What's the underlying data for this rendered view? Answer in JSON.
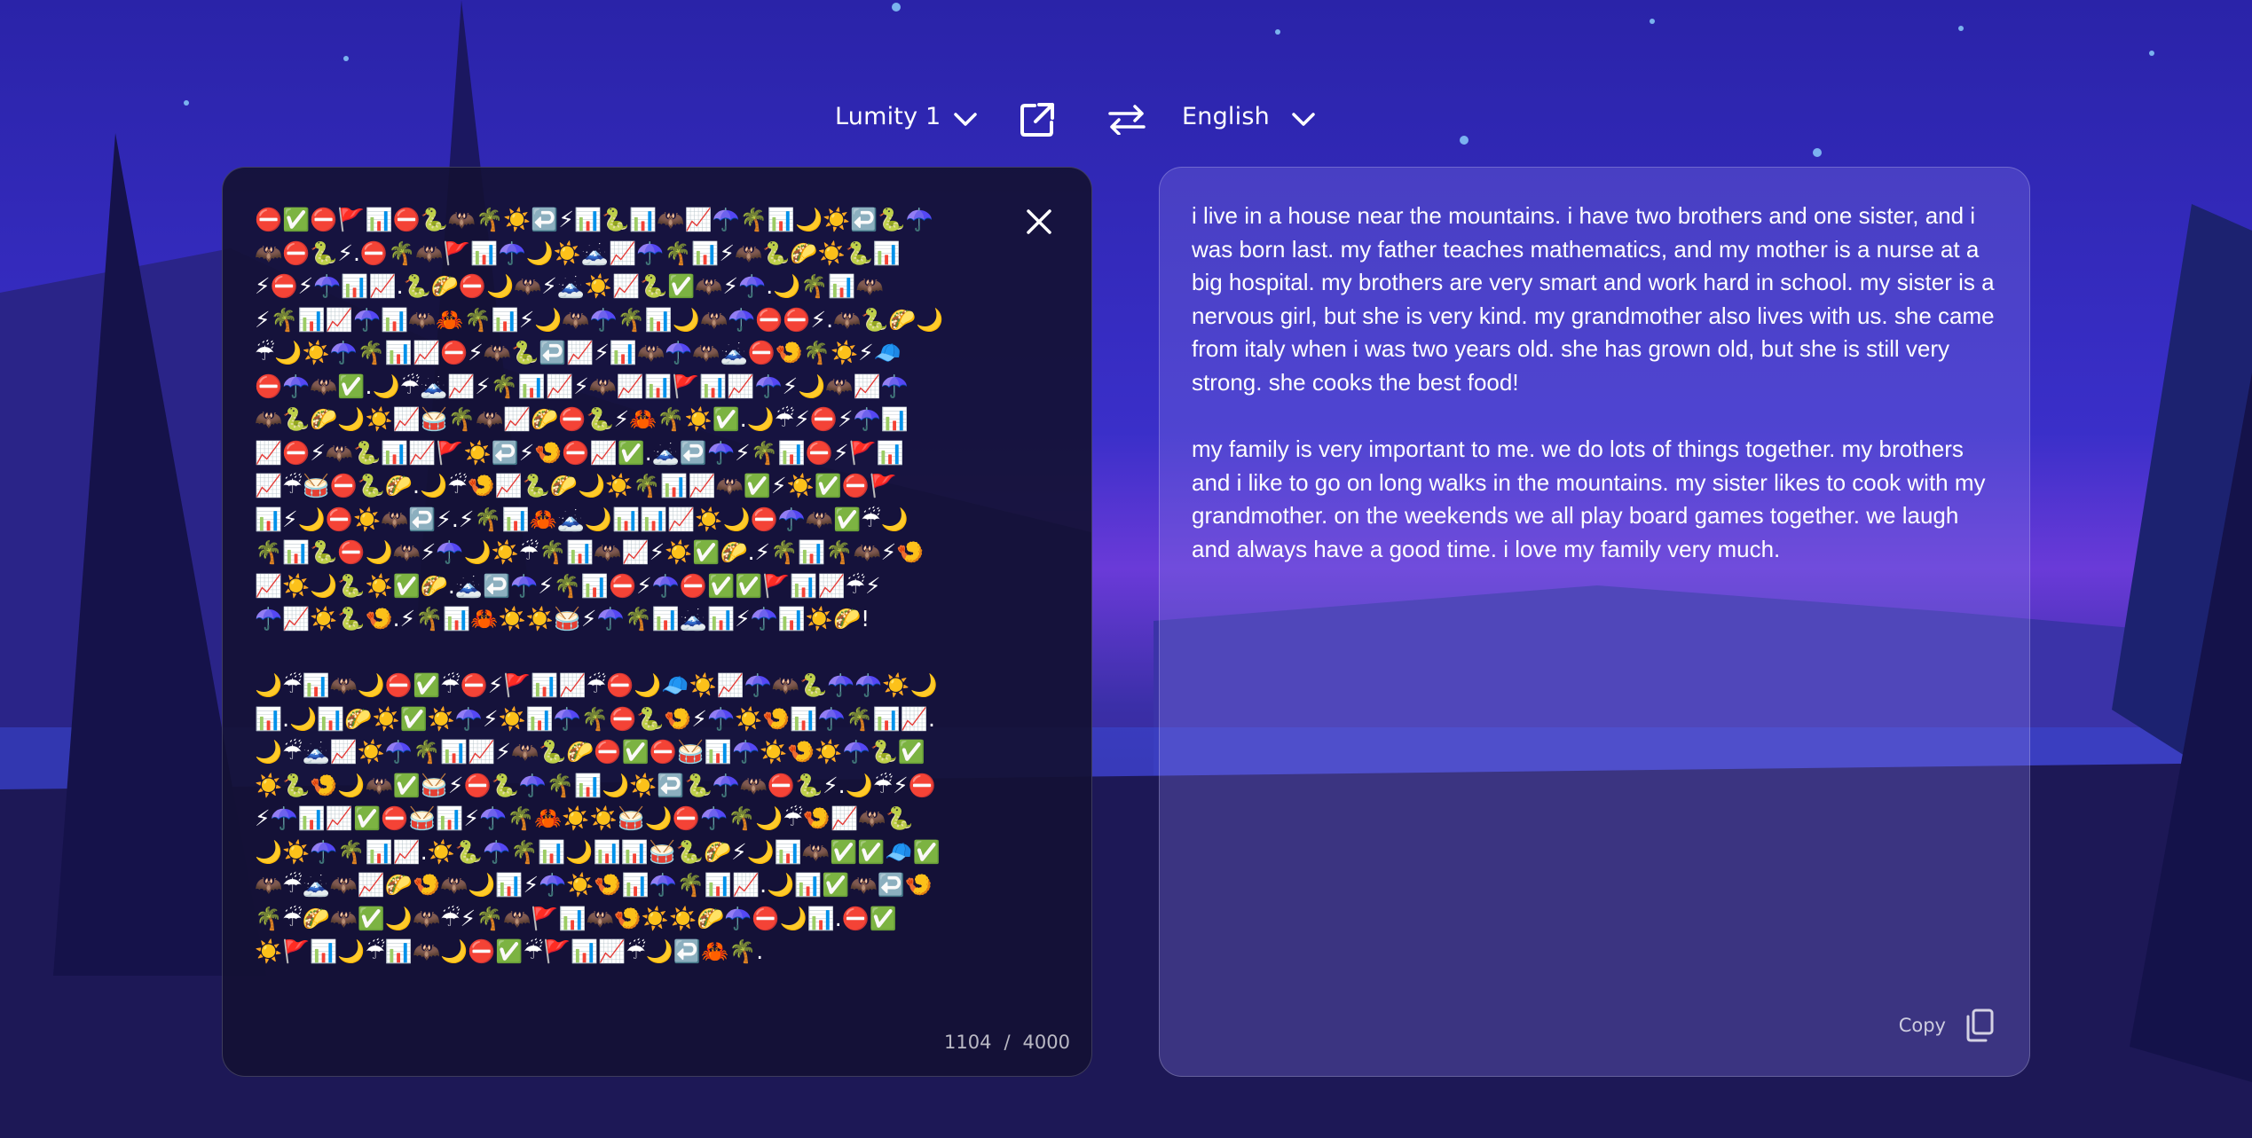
{
  "header": {
    "source_model": "Lumity 1",
    "target_language": "English"
  },
  "source_panel": {
    "text": "⛔✅⛔🚩📊⛔🐍🦇🌴☀️↩️⚡📊🐍📊🦇📈☂️🌴📊🌙☀️↩️🐍☂️\n🦇⛔🐍⚡.⛔🌴🦇🚩📊☂️🌙☀️🗻📈☂️🌴📊⚡🦇🐍🌮☀️🐍📊\n⚡⛔⚡☂️📊📈.🐍🌮⛔🌙🦇⚡🗻☀️📈🐍✅🦇⚡☂️.🌙🌴📊🦇\n⚡🌴📊📈☂️📊🦇🦀🌴📊⚡🌙🦇☂️🌴📊🌙🦇☂️⛔⛔⚡.🦇🐍🌮🌙\n☔🌙☀️☂️🌴📊📈⛔⚡🦇🐍↩️📈⚡📊🦇☂️🦇🗻⛔🍤🌴☀️⚡🧢\n⛔☂️🦇✅.🌙☔🗻📈⚡🌴📊📈⚡🦇📈📊🚩📊📈☂️⚡🌙🦇📈☂️\n🦇🐍🌮🌙☀️📈🥁🌴🦇📈🌮⛔🐍⚡🦀🌴☀️✅.🌙☔⚡⛔⚡☂️📊\n📈⛔⚡🦇🐍📊📈🚩☀️↩️⚡🍤⛔📈✅.🗻↩️☂️⚡🌴📊⛔⚡🚩📊\n📈☔🥁⛔🐍🌮.🌙☔🍤📈🐍🌮🌙☀️🌴📊📈🦇✅⚡☀️✅⛔🚩\n📊⚡🌙⛔☀️🦇↩️⚡.⚡🌴📊🦀🗻🌙📊📊📈☀️🌙⛔☂️🦇✅☔🌙\n🌴📊🐍⛔🌙🦇⚡☂️🌙☀️☔🌴📊🦇📈⚡☀️✅🌮.⚡🌴📊🌴🦇⚡🍤\n📈☀️🌙🐍☀️✅🌮.🗻↩️☂️⚡🌴📊⛔⚡☂️⛔✅✅🚩📊📈☔⚡\n☂️📈☀️🐍🍤.⚡🌴📊🦀☀️☀️🥁⚡☂️🌴📊🗻📊⚡☂️📊☀️🌮!\n\n🌙☔📊🦇🌙⛔✅☔⛔⚡🚩📊📈☔⛔🌙🧢☀️📈☂️🦇🐍☂️☂️☀️🌙\n📊.🌙📊🌮☀️✅☀️☂️⚡☀️📊☂️🌴⛔🐍🍤⚡☂️☀️🍤📊☂️🌴📊📈.\n🌙☔🗻📈☀️☂️🌴📊📈⚡🦇🐍🌮⛔✅⛔🥁📊☂️☀️🍤☀️☂️🐍✅\n☀️🐍🍤🌙🦇✅🥁⚡⛔🐍☂️🌴📊🌙☀️↩️🐍☂️🦇⛔🐍⚡.🌙☔⚡⛔\n⚡☂️📊📈✅⛔🥁📊⚡☂️🌴🦀☀️☀️🥁🌙⛔☂️🌴🌙☔🍤📈🦇🐍\n🌙☀️☂️🌴📊📈.☀️🐍☂️🌴📊🌙📊📊🥁🐍🌮⚡🌙📊🦇✅✅🧢✅\n🦇☔🗻🦇📈🌮🍤🦇🌙📊⚡☂️☀️🍤📊☂️🌴📊📈.🌙📊✅🦇↩️🍤\n🌴☔🌮🦇✅🌙🦇☔⚡🌴🦇🚩📊🦇🍤☀️☀️🌮☂️⛔🌙📊.⛔✅\n☀️🚩📊🌙☔📊🦇🌙⛔✅☔🚩📊📈☔🌙↩️🦀🌴.",
    "count_current": "1104",
    "count_separator": "/",
    "count_max": "4000"
  },
  "target_panel": {
    "paragraphs": [
      "i live in a house near the mountains. i have two brothers and one sister, and i was born last. my father teaches mathematics, and my mother is a nurse at a big hospital. my brothers are very smart and work hard in school. my sister is a nervous girl, but she is very kind. my grandmother also lives with us. she came from italy when i was two years old. she has grown old, but she is still very strong. she cooks the best food!",
      "my family is very important to me. we do lots of things together. my brothers and i like to go on long walks in the mountains. my sister likes to cook with my grandmother. on the weekends we all play board games together. we laugh and always have a good time. i love my family very much."
    ],
    "copy_label": "Copy"
  }
}
